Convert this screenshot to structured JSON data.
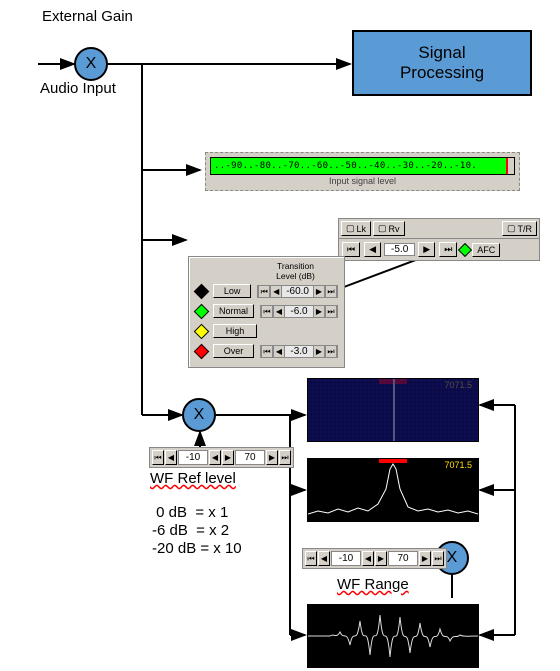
{
  "labels": {
    "external_gain": "External Gain",
    "audio_input": "Audio Input",
    "signal_processing": "Signal\nProcessing",
    "wf_ref": "WF Ref level",
    "wf_range": "WF Range",
    "gain_map": " 0 dB  = x 1\n-6 dB  = x 2\n-20 dB = x 10",
    "mult": "X"
  },
  "meter": {
    "ticks": "..-90..-80..-70..-60..-50..-40..-30..-20..-10.",
    "caption": "Input signal level"
  },
  "afc_strip": {
    "lk": "Lk",
    "rv": "Rv",
    "tr": "T/R",
    "value": "-5.0",
    "afc": "AFC"
  },
  "transition": {
    "title": "Transition\nLevel (dB)",
    "rows": [
      {
        "name": "Low",
        "value": "-60.0",
        "color": "#000000"
      },
      {
        "name": "Normal",
        "value": "-6.0",
        "color": "#00ff00"
      },
      {
        "name": "High",
        "value": "",
        "color": "#ffff00"
      },
      {
        "name": "Over",
        "value": "-3.0",
        "color": "#ff0000"
      }
    ]
  },
  "wf_ref_spin": {
    "a": "-10",
    "b": "70"
  },
  "wf_range_spin": {
    "a": "-10",
    "b": "70"
  },
  "freq_tag": "7071.5",
  "chart_data": {
    "type": "diagram",
    "note": "Signal flow diagram, not a quantitative chart. No numeric series to extract.",
    "nodes": [
      "Audio Input",
      "External Gain (multiplier)",
      "Signal Processing",
      "Input signal level meter",
      "AFC/Lk/Rv/T-R control strip",
      "Transition Level panel (Low/Normal/High/Over)",
      "WF Ref level multiplier",
      "WF Range multiplier",
      "Waterfall display",
      "Spectrum display",
      "Oscilloscope display"
    ]
  }
}
